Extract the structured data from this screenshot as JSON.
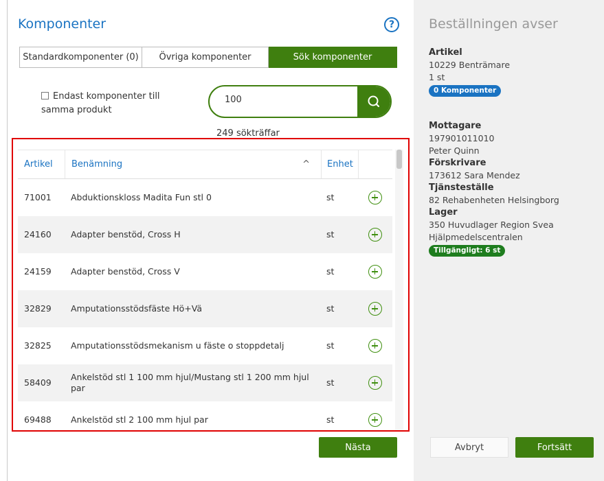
{
  "left": {
    "title": "Komponenter",
    "help_icon": "question-circle-icon",
    "tabs": [
      {
        "label": "Standardkomponenter (0)"
      },
      {
        "label": "Övriga komponenter"
      },
      {
        "label": "Sök komponenter",
        "active": true
      }
    ],
    "checkbox_label": "Endast komponenter till samma produkt",
    "checkbox_checked": false,
    "search": {
      "value": "100",
      "button_icon": "search-icon"
    },
    "hits": "249 sökträffar",
    "table": {
      "headers": {
        "artikel": "Artikel",
        "benamning": "Benämning",
        "sort_icon": "^",
        "enhet": "Enhet"
      },
      "rows": [
        {
          "artikel": "71001",
          "benamning": "Abduktionskloss Madita Fun stl 0",
          "enhet": "st"
        },
        {
          "artikel": "24160",
          "benamning": "Adapter benstöd, Cross H",
          "enhet": "st"
        },
        {
          "artikel": "24159",
          "benamning": "Adapter benstöd, Cross V",
          "enhet": "st"
        },
        {
          "artikel": "32829",
          "benamning": "Amputationsstödsfäste Hö+Vä",
          "enhet": "st"
        },
        {
          "artikel": "32825",
          "benamning": "Amputationsstödsmekanism u fäste o stoppdetalj",
          "enhet": "st"
        },
        {
          "artikel": "58409",
          "benamning": "Ankelstöd stl 1 100 mm hjul/Mustang stl 1 200 mm hjul par",
          "enhet": "st"
        },
        {
          "artikel": "69488",
          "benamning": "Ankelstöd stl 2 100 mm hjul par",
          "enhet": "st"
        }
      ]
    },
    "next_label": "Nästa"
  },
  "right": {
    "title": "Beställningen avser",
    "artikel_label": "Artikel",
    "artikel_value": "10229 Benträmare",
    "quantity": "1 st",
    "komponenter_badge": "0 Komponenter",
    "mottagare_label": "Mottagare",
    "mottagare_id": "197901011010",
    "mottagare_name": "Peter Quinn",
    "forskrivare_label": "Förskrivare",
    "forskrivare_value": "173612 Sara Mendez",
    "tjanst_label": "Tjänsteställe",
    "tjanst_value": "82 Rehabenheten Helsingborg",
    "lager_label": "Lager",
    "lager_value": "350 Huvudlager Region Svea Hjälpmedelscentralen",
    "tillgangligt_badge": "Tillgängligt: 6 st",
    "cancel_label": "Avbryt",
    "continue_label": "Fortsätt"
  },
  "colors": {
    "accent_green": "#3f7f0f",
    "accent_blue": "#1a73c2",
    "highlight_red": "#e00000"
  }
}
